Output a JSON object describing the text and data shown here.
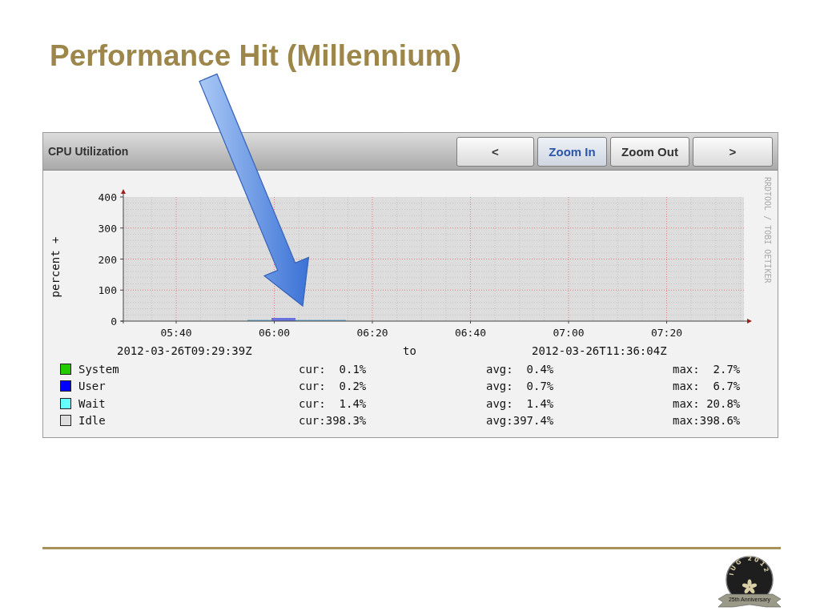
{
  "slide_title": "Performance Hit (Millennium)",
  "panel": {
    "title": "CPU Utilization",
    "buttons": [
      {
        "label": "<",
        "selected": false
      },
      {
        "label": "Zoom In",
        "selected": true
      },
      {
        "label": "Zoom Out",
        "selected": false
      },
      {
        "label": ">",
        "selected": false
      }
    ],
    "chart": {
      "y_label": "percent +",
      "y_ticks": [
        "400",
        "300",
        "200",
        "100",
        "0"
      ],
      "x_ticks": [
        "05:40",
        "06:00",
        "06:20",
        "06:40",
        "07:00",
        "07:20"
      ],
      "credit": "RRDTOOL / TOBI OETIKER"
    },
    "range": {
      "start": "2012-03-26T09:29:39Z",
      "separator": "to",
      "end": "2012-03-26T11:36:04Z"
    },
    "legend": [
      {
        "name": "System",
        "color": "#22cc00",
        "cur": "cur:  0.1%",
        "avg": "avg:  0.4%",
        "max": "max:  2.7%"
      },
      {
        "name": "User",
        "color": "#0000ff",
        "cur": "cur:  0.2%",
        "avg": "avg:  0.7%",
        "max": "max:  6.7%"
      },
      {
        "name": "Wait",
        "color": "#66ffff",
        "cur": "cur:  1.4%",
        "avg": "avg:  1.4%",
        "max": "max: 20.8%"
      },
      {
        "name": "Idle",
        "color": "#dddddd",
        "cur": "cur:398.3%",
        "avg": "avg:397.4%",
        "max": "max:398.6%"
      }
    ]
  },
  "logo": {
    "ring_text": "IUG 2012",
    "ribbon_text": "25th Anniversary"
  }
}
